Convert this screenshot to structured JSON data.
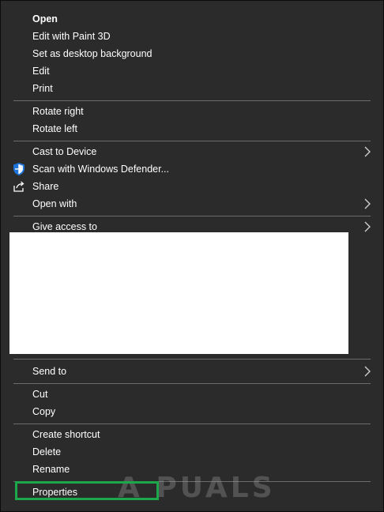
{
  "menu": {
    "open": "Open",
    "edit_paint3d": "Edit with Paint 3D",
    "set_background": "Set as desktop background",
    "edit": "Edit",
    "print": "Print",
    "rotate_right": "Rotate right",
    "rotate_left": "Rotate left",
    "cast_to_device": "Cast to Device",
    "scan_defender": "Scan with Windows Defender...",
    "share": "Share",
    "open_with": "Open with",
    "give_access": "Give access to",
    "send_to": "Send to",
    "cut": "Cut",
    "copy": "Copy",
    "create_shortcut": "Create shortcut",
    "delete": "Delete",
    "rename": "Rename",
    "properties": "Properties"
  },
  "watermark": {
    "text": "A PUALS"
  },
  "icons": {
    "defender": "shield-icon",
    "share": "share-icon",
    "submenu": "chevron-right-icon"
  },
  "colors": {
    "menu_background": "#2b2b2b",
    "text": "#ffffff",
    "separator": "#6c6c6c",
    "highlight_border": "#1ca84a",
    "defender_blue": "#1e73d8"
  }
}
